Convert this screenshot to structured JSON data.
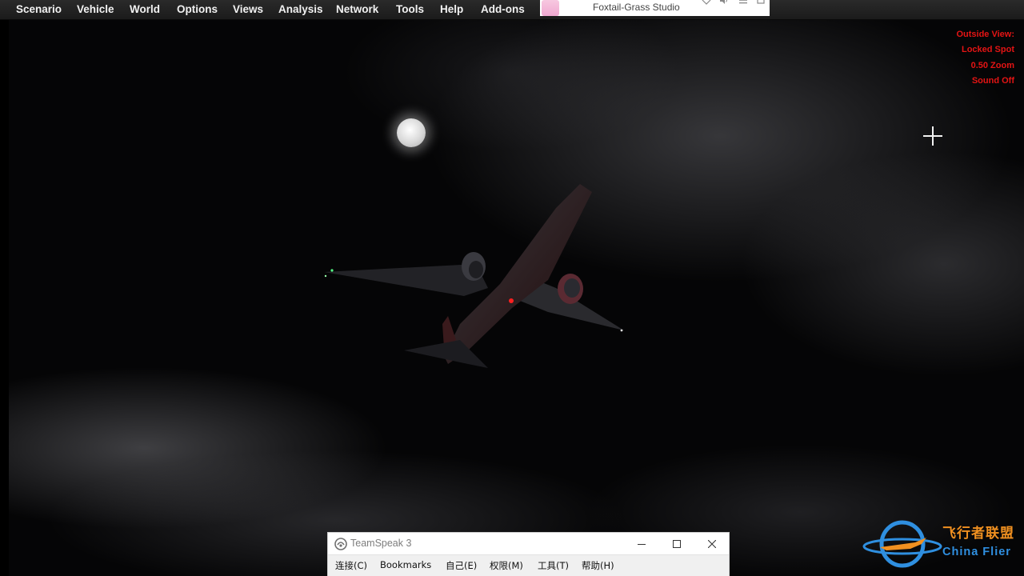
{
  "menubar": {
    "items": [
      "Scenario",
      "Vehicle",
      "World",
      "Options",
      "Views",
      "Analysis",
      "Network",
      "Tools",
      "Help",
      "Add-ons"
    ]
  },
  "notification": {
    "studio_name": "Foxtail-Grass Studio",
    "icons": [
      "heart-icon",
      "speaker-icon",
      "menu-icon",
      "window-icon"
    ]
  },
  "hud": {
    "lines": [
      "Outside View:",
      "Locked Spot",
      "0.50 Zoom",
      "Sound Off"
    ],
    "color": "#e41414"
  },
  "teamspeak": {
    "title": "TeamSpeak 3",
    "controls": [
      "minimize",
      "maximize",
      "close"
    ],
    "menu": [
      "连接(C)",
      "Bookmarks",
      "自己(E)",
      "权限(M)",
      "工具(T)",
      "帮助(H)"
    ]
  },
  "watermark": {
    "cn": "飞行者联盟",
    "en": "China Flier",
    "colors": {
      "cn": "#f09020",
      "en": "#2f8fe0"
    }
  }
}
